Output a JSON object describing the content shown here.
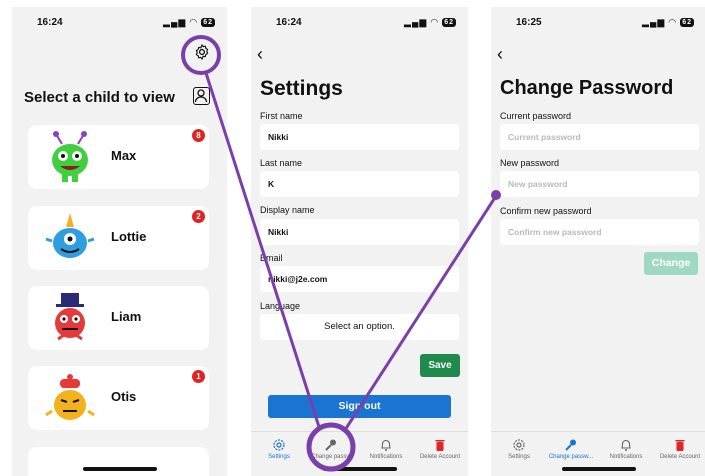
{
  "status": {
    "time_1": "16:24",
    "time_2": "16:24",
    "time_3": "16:25",
    "battery": "62"
  },
  "child_list": {
    "title": "Select a child to view",
    "children": [
      {
        "name": "Max",
        "badge": "8",
        "color": "#3fcf3f"
      },
      {
        "name": "Lottie",
        "badge": "2",
        "color": "#2f9de0"
      },
      {
        "name": "Liam",
        "badge": "",
        "color": "#e53a3a"
      },
      {
        "name": "Otis",
        "badge": "1",
        "color": "#f2b21d"
      }
    ]
  },
  "settings": {
    "back": "‹",
    "title": "Settings",
    "first_name_label": "First name",
    "first_name": "Nikki",
    "last_name_label": "Last name",
    "last_name": "K",
    "display_name_label": "Display name",
    "display_name": "Nikki",
    "email_label": "Email",
    "email": "nikki@j2e.com",
    "language_label": "Language",
    "language_value": "Select an option.",
    "save": "Save",
    "signout": "Sign out"
  },
  "change_password": {
    "back": "‹",
    "title": "Change Password",
    "current_label": "Current password",
    "current_placeholder": "Current password",
    "new_label": "New password",
    "new_placeholder": "New password",
    "confirm_label": "Confirm new password",
    "confirm_placeholder": "Confirm new password",
    "change": "Change"
  },
  "tabs_settings_screen": [
    "Settings",
    "Change passw",
    "Notifications",
    "Delete Account"
  ],
  "tabs_password_screen": [
    "Settings",
    "Change passw...",
    "Notifications",
    "Delete Account"
  ],
  "colors": {
    "annotation": "#7a3fa8",
    "primary": "#1975d1",
    "save": "#1f8a4c",
    "danger": "#e02424"
  }
}
